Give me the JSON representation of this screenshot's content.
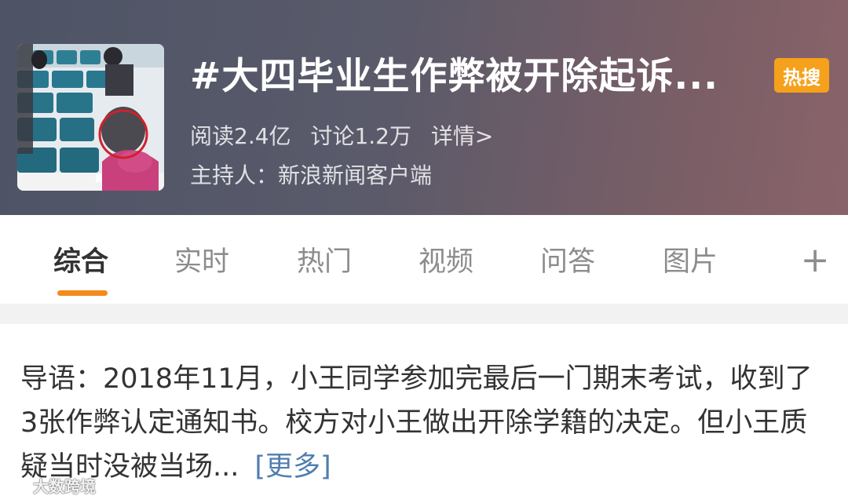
{
  "topic": {
    "title": "#大四毕业生作弊被开除起诉...",
    "hot_badge": "热搜",
    "reads": "阅读2.4亿",
    "discussions": "讨论1.2万",
    "details_link": "详情>",
    "host": "主持人：新浪新闻客户端"
  },
  "tabs": [
    {
      "label": "综合",
      "active": true
    },
    {
      "label": "实时",
      "active": false
    },
    {
      "label": "热门",
      "active": false
    },
    {
      "label": "视频",
      "active": false
    },
    {
      "label": "问答",
      "active": false
    },
    {
      "label": "图片",
      "active": false
    }
  ],
  "add_tab_label": "+",
  "lead": {
    "text": "导语：2018年11月，小王同学参加完最后一门期末考试，收到了3张作弊认定通知书。校方对小王做出开除学籍的决定。但小王质疑当时没被当场...",
    "more_label": "[更多]"
  },
  "watermark": {
    "text": "大数跨境"
  },
  "colors": {
    "accent_orange": "#f28b1b",
    "hot_badge": "#f5a11c",
    "link_blue": "#507daf",
    "active_tab_text": "#333333",
    "inactive_tab_text": "#8c8c8c"
  }
}
